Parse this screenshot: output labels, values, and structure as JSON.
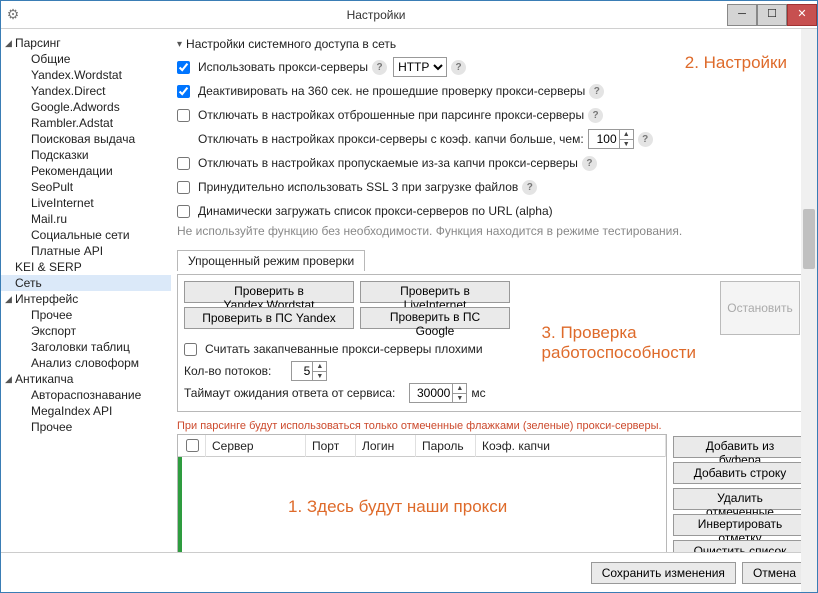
{
  "window": {
    "title": "Настройки"
  },
  "tree": {
    "groups": [
      {
        "label": "Парсинг",
        "children": [
          "Общие",
          "Yandex.Wordstat",
          "Yandex.Direct",
          "Google.Adwords",
          "Rambler.Adstat",
          "Поисковая выдача",
          "Подсказки",
          "Рекомендации",
          "SeoPult",
          "LiveInternet",
          "Mail.ru",
          "Социальные сети",
          "Платные API",
          "KEI & SERP",
          "Сеть"
        ]
      },
      {
        "label": "Интерфейс",
        "children": [
          "Прочее",
          "Экспорт",
          "Заголовки таблиц",
          "Анализ словоформ"
        ]
      },
      {
        "label": "Антикапча",
        "children": [
          "Автораспознавание",
          "MegaIndex API",
          "Прочее"
        ]
      }
    ],
    "selected": "Сеть"
  },
  "section": {
    "title": "Настройки системного доступа в сеть"
  },
  "opts": {
    "useProxy": {
      "label": "Использовать прокси-серверы",
      "checked": true,
      "protocol": "HTTP"
    },
    "deactivate360": {
      "label": "Деактивировать на 360 сек. не прошедшие проверку прокси-серверы",
      "checked": true
    },
    "disableRejected": {
      "label": "Отключать в настройках отброшенные при парсинге прокси-серверы",
      "checked": false
    },
    "disableCaptchaCoef": {
      "label": "Отключать в настройках прокси-серверы с коэф. капчи больше, чем:",
      "value": "100"
    },
    "disableSkipped": {
      "label": "Отключать в настройках пропускаемые из-за капчи прокси-серверы",
      "checked": false
    },
    "forceSSL3": {
      "label": "Принудительно использовать SSL 3 при загрузке файлов",
      "checked": false
    },
    "dynamicURL": {
      "label": "Динамически загружать список прокси-серверов по URL (alpha)",
      "checked": false
    },
    "note": "Не используйте функцию без необходимости. Функция находится в режиме тестирования."
  },
  "check": {
    "tab": "Упрощенный режим проверки",
    "btnYW": "Проверить в Yandex.Wordstat",
    "btnLI": "Проверить в LiveInternet",
    "btnPSY": "Проверить в ПС Yandex",
    "btnPSG": "Проверить в ПС Google",
    "stop": "Остановить",
    "countCaptchaBad": {
      "label": "Считать закапчеванные прокси-серверы плохими",
      "checked": false
    },
    "threadsLabel": "Кол-во потоков:",
    "threadsValue": "5",
    "timeoutLabel": "Таймаут ожидания ответа от сервиса:",
    "timeoutValue": "30000",
    "timeoutUnit": "мс"
  },
  "tableWarn": "При парсинге будут использоваться только отмеченные флажками (зеленые) прокси-серверы.",
  "tableCols": [
    "Сервер",
    "Порт",
    "Логин",
    "Пароль",
    "Коэф. капчи"
  ],
  "sideButtons": [
    "Добавить из буфера",
    "Добавить строку",
    "Удалить отмеченные",
    "Инвертировать отметку",
    "Очистить список"
  ],
  "footer": {
    "save": "Сохранить изменения",
    "cancel": "Отмена"
  },
  "annotations": {
    "a1": "1. Здесь будут наши прокси",
    "a2": "2. Настройки",
    "a3_1": "3. Проверка",
    "a3_2": "работоспособности"
  }
}
